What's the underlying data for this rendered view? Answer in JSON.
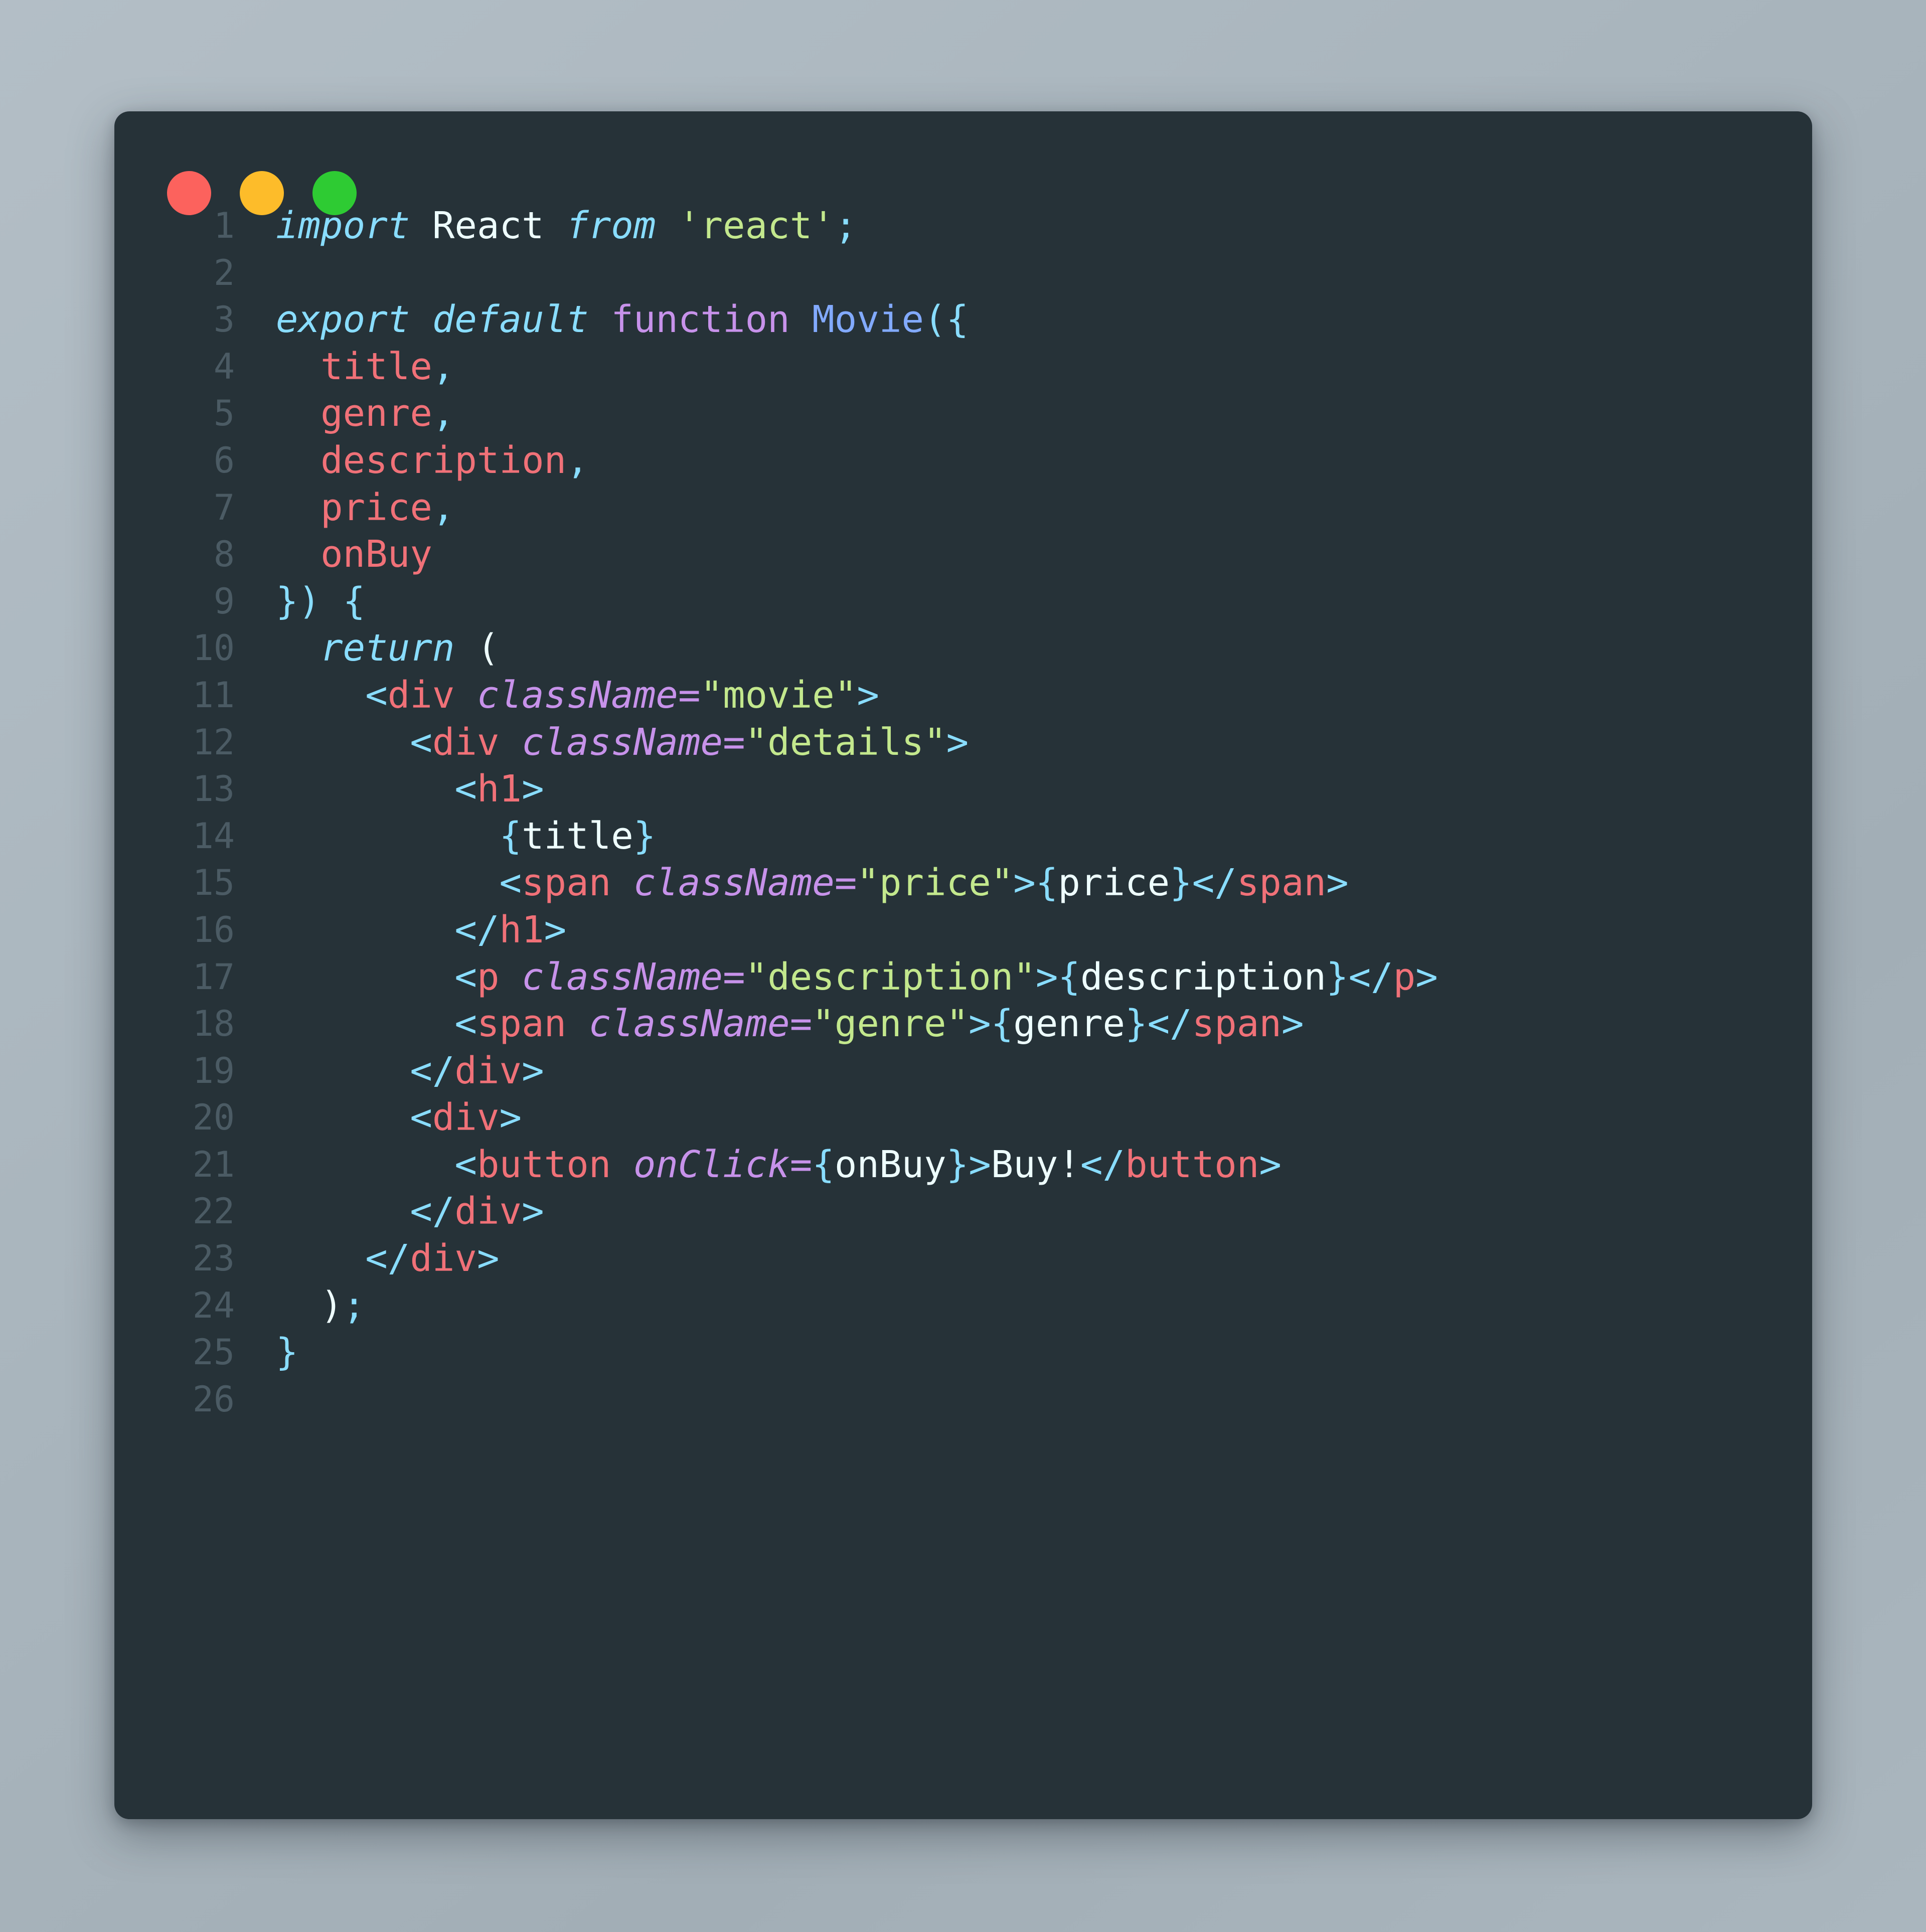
{
  "window": {
    "traffic_lights": [
      {
        "name": "close",
        "color": "#fc625d"
      },
      {
        "name": "minimize",
        "color": "#fdbc2a"
      },
      {
        "name": "maximize",
        "color": "#2ecb33"
      }
    ],
    "background_color": "#263238",
    "page_background_color": "#a9b5bd"
  },
  "editor": {
    "language": "jsx",
    "line_count": 26,
    "lines": [
      {
        "n": "1",
        "text": "import React from 'react';"
      },
      {
        "n": "2",
        "text": ""
      },
      {
        "n": "3",
        "text": "export default function Movie({"
      },
      {
        "n": "4",
        "text": "  title,"
      },
      {
        "n": "5",
        "text": "  genre,"
      },
      {
        "n": "6",
        "text": "  description,"
      },
      {
        "n": "7",
        "text": "  price,"
      },
      {
        "n": "8",
        "text": "  onBuy"
      },
      {
        "n": "9",
        "text": "}) {"
      },
      {
        "n": "10",
        "text": "  return ("
      },
      {
        "n": "11",
        "text": "    <div className=\"movie\">"
      },
      {
        "n": "12",
        "text": "      <div className=\"details\">"
      },
      {
        "n": "13",
        "text": "        <h1>"
      },
      {
        "n": "14",
        "text": "          {title}"
      },
      {
        "n": "15",
        "text": "          <span className=\"price\">{price}</span>"
      },
      {
        "n": "16",
        "text": "        </h1>"
      },
      {
        "n": "17",
        "text": "        <p className=\"description\">{description}</p>"
      },
      {
        "n": "18",
        "text": "        <span className=\"genre\">{genre}</span>"
      },
      {
        "n": "19",
        "text": "      </div>"
      },
      {
        "n": "20",
        "text": "      <div>"
      },
      {
        "n": "21",
        "text": "        <button onClick={onBuy}>Buy!</button>"
      },
      {
        "n": "22",
        "text": "      </div>"
      },
      {
        "n": "23",
        "text": "    </div>"
      },
      {
        "n": "24",
        "text": "  );"
      },
      {
        "n": "25",
        "text": "}"
      },
      {
        "n": "26",
        "text": ""
      }
    ],
    "tokens": [
      [
        {
          "t": "import ",
          "c": "t-keyword"
        },
        {
          "t": "React ",
          "c": "t-plain"
        },
        {
          "t": "from ",
          "c": "t-keyword"
        },
        {
          "t": "'react'",
          "c": "t-string"
        },
        {
          "t": ";",
          "c": "t-punct"
        }
      ],
      [],
      [
        {
          "t": "export default ",
          "c": "t-keyword"
        },
        {
          "t": "function ",
          "c": "t-function"
        },
        {
          "t": "Movie",
          "c": "t-funcname"
        },
        {
          "t": "({",
          "c": "t-punct"
        }
      ],
      [
        {
          "t": "  ",
          "c": "t-plain"
        },
        {
          "t": "title",
          "c": "t-param"
        },
        {
          "t": ",",
          "c": "t-punct"
        }
      ],
      [
        {
          "t": "  ",
          "c": "t-plain"
        },
        {
          "t": "genre",
          "c": "t-param"
        },
        {
          "t": ",",
          "c": "t-punct"
        }
      ],
      [
        {
          "t": "  ",
          "c": "t-plain"
        },
        {
          "t": "description",
          "c": "t-param"
        },
        {
          "t": ",",
          "c": "t-punct"
        }
      ],
      [
        {
          "t": "  ",
          "c": "t-plain"
        },
        {
          "t": "price",
          "c": "t-param"
        },
        {
          "t": ",",
          "c": "t-punct"
        }
      ],
      [
        {
          "t": "  ",
          "c": "t-plain"
        },
        {
          "t": "onBuy",
          "c": "t-param"
        }
      ],
      [
        {
          "t": "}) {",
          "c": "t-punct"
        }
      ],
      [
        {
          "t": "  ",
          "c": "t-plain"
        },
        {
          "t": "return ",
          "c": "t-keyword"
        },
        {
          "t": "(",
          "c": "t-white"
        }
      ],
      [
        {
          "t": "    ",
          "c": "t-plain"
        },
        {
          "t": "<",
          "c": "t-punct"
        },
        {
          "t": "div",
          "c": "t-tag"
        },
        {
          "t": " ",
          "c": "t-plain"
        },
        {
          "t": "className",
          "c": "t-attr"
        },
        {
          "t": "=",
          "c": "t-operator"
        },
        {
          "t": "\"movie\"",
          "c": "t-string"
        },
        {
          "t": ">",
          "c": "t-punct"
        }
      ],
      [
        {
          "t": "      ",
          "c": "t-plain"
        },
        {
          "t": "<",
          "c": "t-punct"
        },
        {
          "t": "div",
          "c": "t-tag"
        },
        {
          "t": " ",
          "c": "t-plain"
        },
        {
          "t": "className",
          "c": "t-attr"
        },
        {
          "t": "=",
          "c": "t-operator"
        },
        {
          "t": "\"details\"",
          "c": "t-string"
        },
        {
          "t": ">",
          "c": "t-punct"
        }
      ],
      [
        {
          "t": "        ",
          "c": "t-plain"
        },
        {
          "t": "<",
          "c": "t-punct"
        },
        {
          "t": "h1",
          "c": "t-tag"
        },
        {
          "t": ">",
          "c": "t-punct"
        }
      ],
      [
        {
          "t": "          ",
          "c": "t-plain"
        },
        {
          "t": "{",
          "c": "t-brace"
        },
        {
          "t": "title",
          "c": "t-white"
        },
        {
          "t": "}",
          "c": "t-brace"
        }
      ],
      [
        {
          "t": "          ",
          "c": "t-plain"
        },
        {
          "t": "<",
          "c": "t-punct"
        },
        {
          "t": "span",
          "c": "t-tag"
        },
        {
          "t": " ",
          "c": "t-plain"
        },
        {
          "t": "className",
          "c": "t-attr"
        },
        {
          "t": "=",
          "c": "t-operator"
        },
        {
          "t": "\"price\"",
          "c": "t-string"
        },
        {
          "t": ">",
          "c": "t-punct"
        },
        {
          "t": "{",
          "c": "t-brace"
        },
        {
          "t": "price",
          "c": "t-white"
        },
        {
          "t": "}",
          "c": "t-brace"
        },
        {
          "t": "</",
          "c": "t-punct"
        },
        {
          "t": "span",
          "c": "t-tag"
        },
        {
          "t": ">",
          "c": "t-punct"
        }
      ],
      [
        {
          "t": "        ",
          "c": "t-plain"
        },
        {
          "t": "</",
          "c": "t-punct"
        },
        {
          "t": "h1",
          "c": "t-tag"
        },
        {
          "t": ">",
          "c": "t-punct"
        }
      ],
      [
        {
          "t": "        ",
          "c": "t-plain"
        },
        {
          "t": "<",
          "c": "t-punct"
        },
        {
          "t": "p",
          "c": "t-tag"
        },
        {
          "t": " ",
          "c": "t-plain"
        },
        {
          "t": "className",
          "c": "t-attr"
        },
        {
          "t": "=",
          "c": "t-operator"
        },
        {
          "t": "\"description\"",
          "c": "t-string"
        },
        {
          "t": ">",
          "c": "t-punct"
        },
        {
          "t": "{",
          "c": "t-brace"
        },
        {
          "t": "description",
          "c": "t-white"
        },
        {
          "t": "}",
          "c": "t-brace"
        },
        {
          "t": "</",
          "c": "t-punct"
        },
        {
          "t": "p",
          "c": "t-tag"
        },
        {
          "t": ">",
          "c": "t-punct"
        }
      ],
      [
        {
          "t": "        ",
          "c": "t-plain"
        },
        {
          "t": "<",
          "c": "t-punct"
        },
        {
          "t": "span",
          "c": "t-tag"
        },
        {
          "t": " ",
          "c": "t-plain"
        },
        {
          "t": "className",
          "c": "t-attr"
        },
        {
          "t": "=",
          "c": "t-operator"
        },
        {
          "t": "\"genre\"",
          "c": "t-string"
        },
        {
          "t": ">",
          "c": "t-punct"
        },
        {
          "t": "{",
          "c": "t-brace"
        },
        {
          "t": "genre",
          "c": "t-white"
        },
        {
          "t": "}",
          "c": "t-brace"
        },
        {
          "t": "</",
          "c": "t-punct"
        },
        {
          "t": "span",
          "c": "t-tag"
        },
        {
          "t": ">",
          "c": "t-punct"
        }
      ],
      [
        {
          "t": "      ",
          "c": "t-plain"
        },
        {
          "t": "</",
          "c": "t-punct"
        },
        {
          "t": "div",
          "c": "t-tag"
        },
        {
          "t": ">",
          "c": "t-punct"
        }
      ],
      [
        {
          "t": "      ",
          "c": "t-plain"
        },
        {
          "t": "<",
          "c": "t-punct"
        },
        {
          "t": "div",
          "c": "t-tag"
        },
        {
          "t": ">",
          "c": "t-punct"
        }
      ],
      [
        {
          "t": "        ",
          "c": "t-plain"
        },
        {
          "t": "<",
          "c": "t-punct"
        },
        {
          "t": "button",
          "c": "t-tag"
        },
        {
          "t": " ",
          "c": "t-plain"
        },
        {
          "t": "onClick",
          "c": "t-attr"
        },
        {
          "t": "=",
          "c": "t-operator"
        },
        {
          "t": "{",
          "c": "t-brace"
        },
        {
          "t": "onBuy",
          "c": "t-white"
        },
        {
          "t": "}",
          "c": "t-brace"
        },
        {
          "t": ">",
          "c": "t-punct"
        },
        {
          "t": "Buy!",
          "c": "t-white"
        },
        {
          "t": "</",
          "c": "t-punct"
        },
        {
          "t": "button",
          "c": "t-tag"
        },
        {
          "t": ">",
          "c": "t-punct"
        }
      ],
      [
        {
          "t": "      ",
          "c": "t-plain"
        },
        {
          "t": "</",
          "c": "t-punct"
        },
        {
          "t": "div",
          "c": "t-tag"
        },
        {
          "t": ">",
          "c": "t-punct"
        }
      ],
      [
        {
          "t": "    ",
          "c": "t-plain"
        },
        {
          "t": "</",
          "c": "t-punct"
        },
        {
          "t": "div",
          "c": "t-tag"
        },
        {
          "t": ">",
          "c": "t-punct"
        }
      ],
      [
        {
          "t": "  ",
          "c": "t-plain"
        },
        {
          "t": ")",
          "c": "t-white"
        },
        {
          "t": ";",
          "c": "t-punct"
        }
      ],
      [
        {
          "t": "}",
          "c": "t-punct"
        }
      ],
      []
    ]
  }
}
